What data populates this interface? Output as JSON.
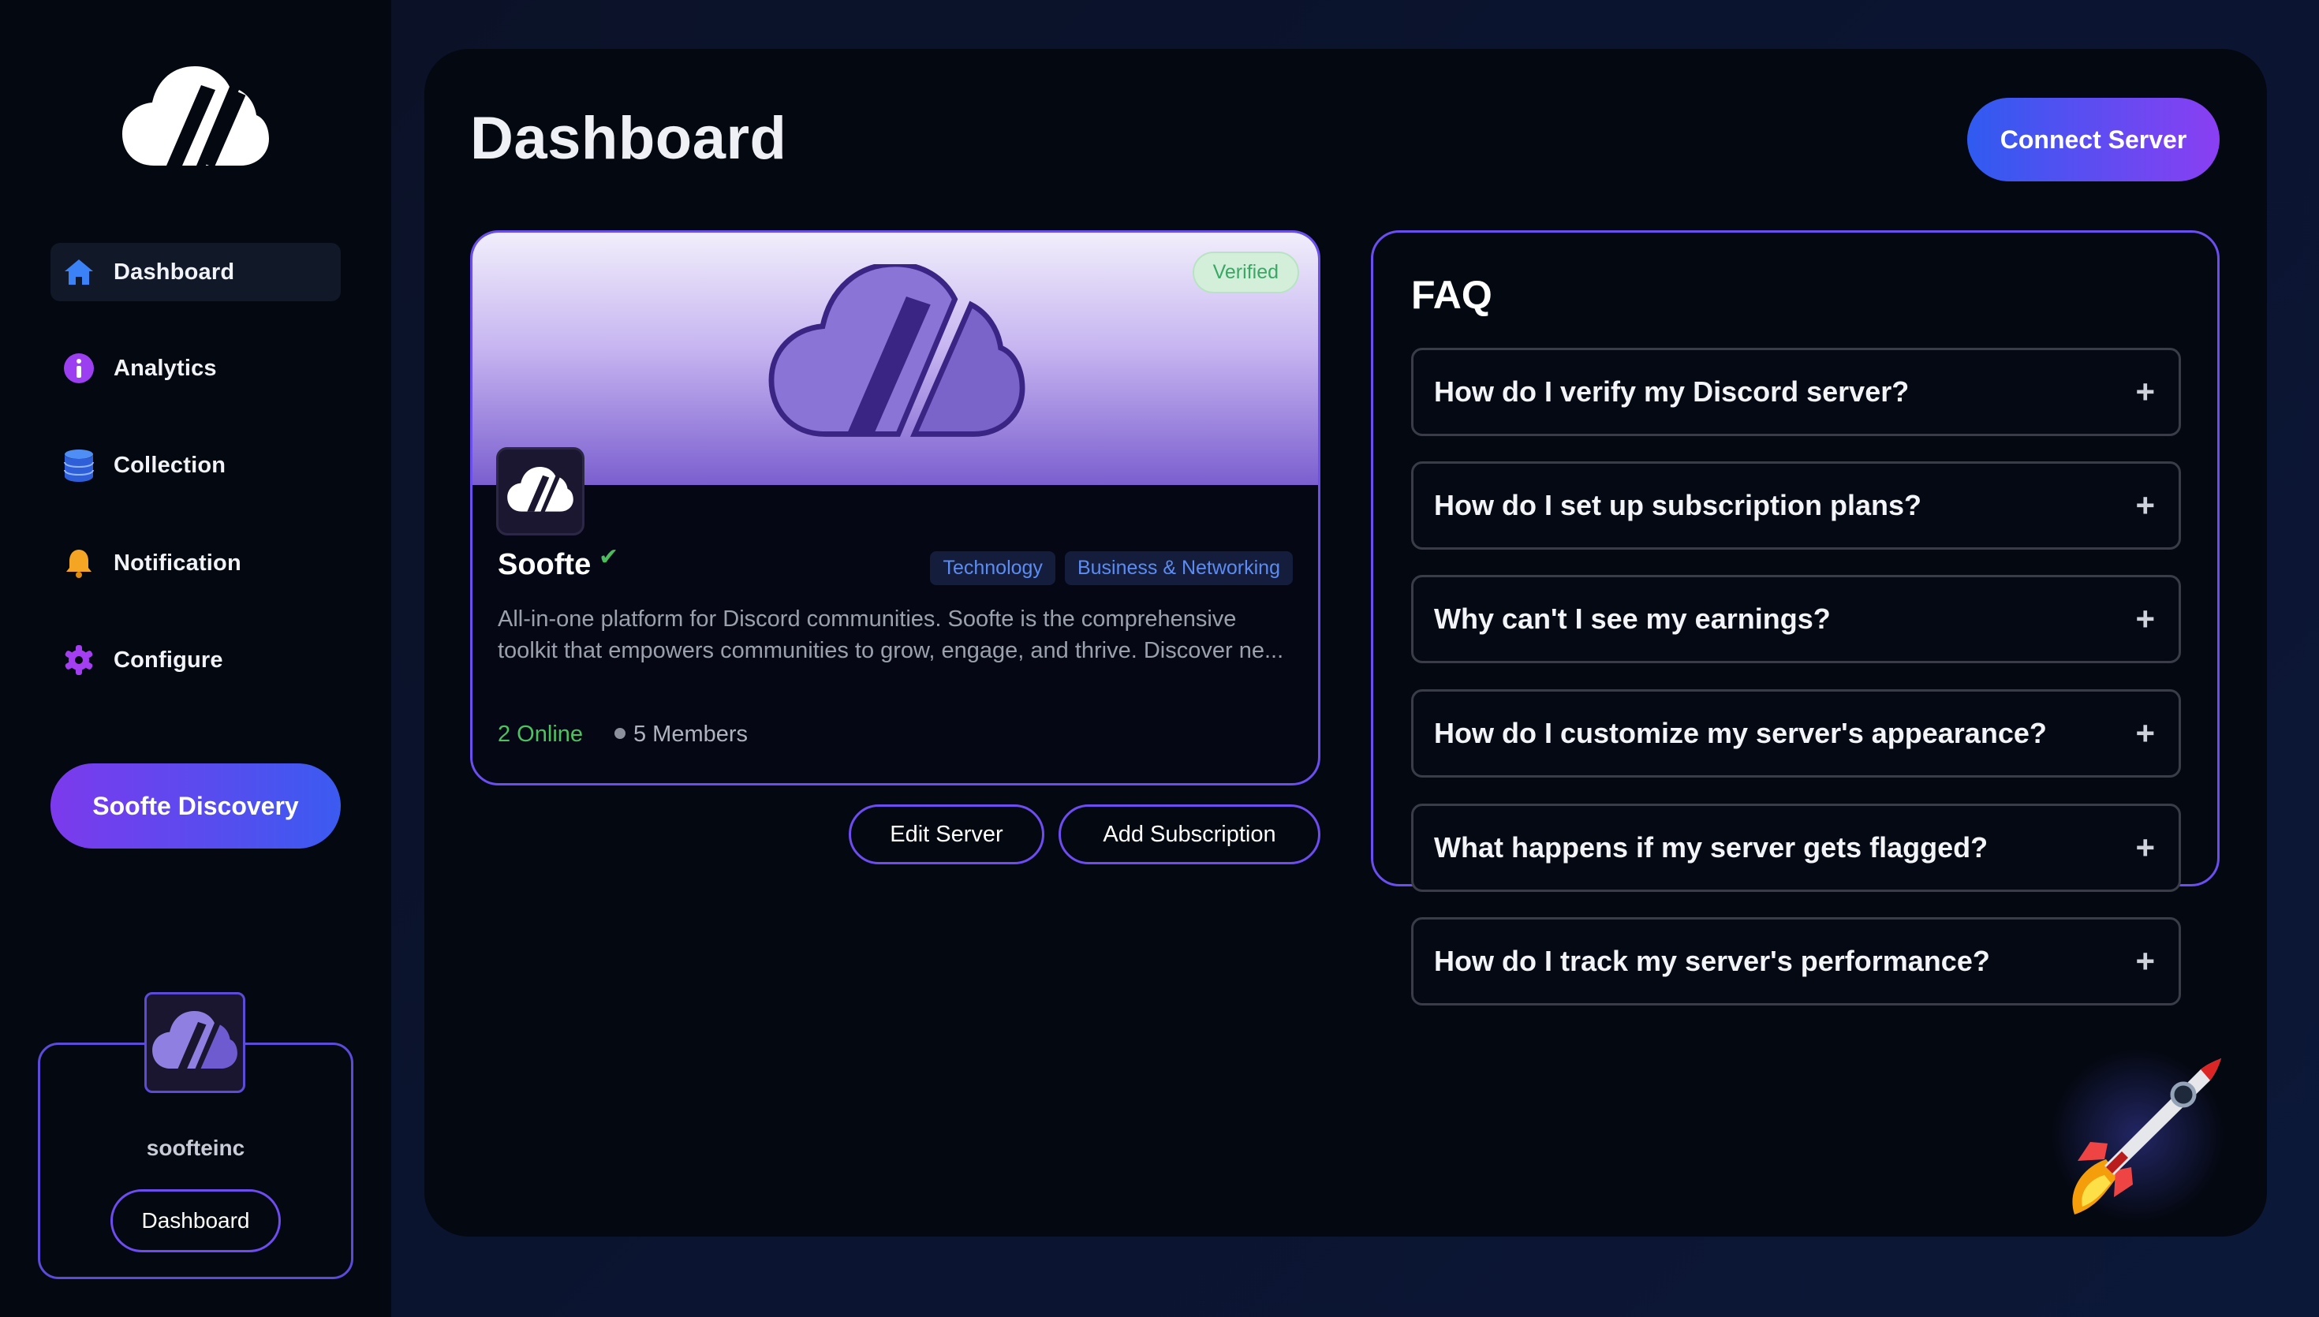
{
  "sidebar": {
    "items": [
      {
        "label": "Dashboard",
        "icon": "home-icon",
        "active": true
      },
      {
        "label": "Analytics",
        "icon": "info-icon",
        "active": false
      },
      {
        "label": "Collection",
        "icon": "database-icon",
        "active": false
      },
      {
        "label": "Notification",
        "icon": "bell-icon",
        "active": false
      },
      {
        "label": "Configure",
        "icon": "gear-icon",
        "active": false
      }
    ],
    "discovery_label": "Soofte Discovery",
    "user": {
      "username": "soofteinc",
      "button_label": "Dashboard"
    }
  },
  "header": {
    "title": "Dashboard",
    "connect_label": "Connect Server"
  },
  "server": {
    "badge": "Verified",
    "name": "Soofte",
    "check": "✔",
    "tags": [
      "Technology",
      "Business & Networking"
    ],
    "description": "All-in-one platform for Discord communities.  Soofte is the comprehensive toolkit that empowers communities to grow, engage, and thrive. Discover ne...",
    "online": "2 Online",
    "members": "5 Members",
    "edit_label": "Edit Server",
    "add_subscription_label": "Add Subscription"
  },
  "faq": {
    "title": "FAQ",
    "items": [
      "How do I verify my Discord server?",
      "How do I set up subscription plans?",
      "Why can't I see my earnings?",
      "How do I customize my server's appearance?",
      "What happens if my server gets flagged?",
      "How do I track my server's performance?"
    ],
    "expand_symbol": "+"
  },
  "colors": {
    "accent_purple": "#7c3aed",
    "accent_blue": "#3b5bf0",
    "online_green": "#4cc35f",
    "tag_blue": "#5c8cf2"
  }
}
